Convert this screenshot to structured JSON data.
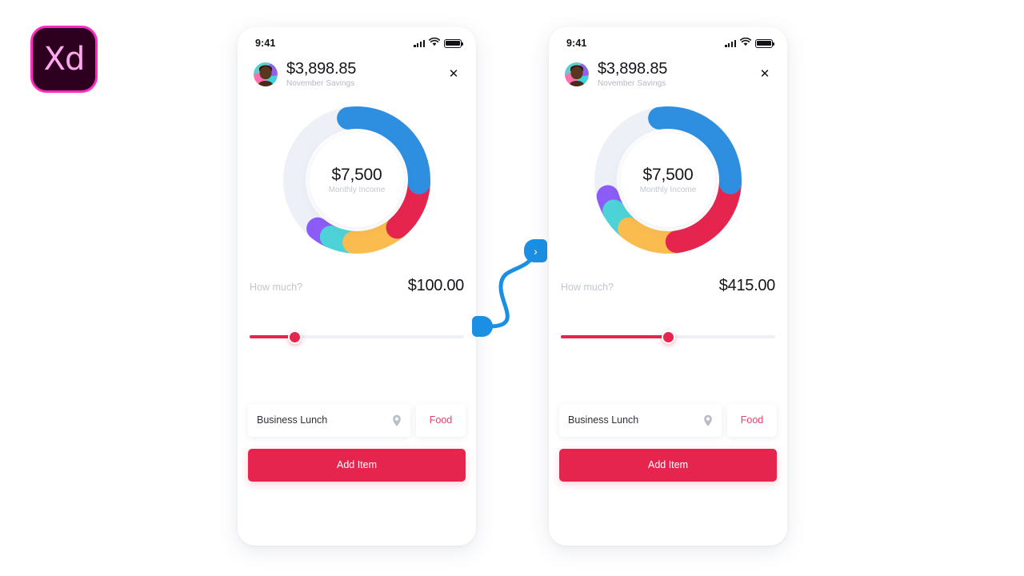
{
  "app": {
    "logo_text": "Xd",
    "logo_name": "adobe-xd-logo",
    "accent_pink": "#e6254f",
    "accent_blue": "#1a8fe3",
    "canvas_background": "#ffffff"
  },
  "connector": {
    "arrow_glyph": "›",
    "color": "#1a8fe3"
  },
  "screens": [
    {
      "id": "screen-1",
      "statusbar": {
        "time": "9:41",
        "signal_icon": "signal-bars-icon",
        "wifi_icon": "wifi-icon",
        "battery_icon": "battery-icon"
      },
      "header": {
        "avatar_name": "user-avatar",
        "amount": "$3,898.85",
        "subtitle": "November Savings",
        "close_glyph": "✕"
      },
      "donut": {
        "center_value": "$7,500",
        "center_label": "Monthly Income",
        "track_color": "#edf0f7"
      },
      "amount_row": {
        "label": "How much?",
        "value": "$100.00"
      },
      "slider": {
        "percent": 21,
        "fill_color": "#e6254f",
        "track_color": "#eef0f6"
      },
      "form": {
        "input_value": "Business Lunch",
        "input_placeholder": "Business Lunch",
        "pin_icon": "location-pin-icon",
        "tag_label": "Food",
        "button_label": "Add Item"
      },
      "chart_data": {
        "type": "pie",
        "title": "Monthly Income",
        "center_value": "$7,500",
        "center_label": "Monthly Income",
        "legend_position": "none",
        "categories": [
          "Blue",
          "Crimson",
          "Yellow",
          "Teal",
          "Purple"
        ],
        "values": [
          28,
          13,
          12,
          6,
          4
        ],
        "colors": [
          "#2e8fe0",
          "#e6254f",
          "#fbbc4f",
          "#4dd2d8",
          "#8b5cf6"
        ],
        "track_color": "#edf0f7",
        "start_angle_deg": -8,
        "total_ring_deg": 360
      }
    },
    {
      "id": "screen-2",
      "statusbar": {
        "time": "9:41",
        "signal_icon": "signal-bars-icon",
        "wifi_icon": "wifi-icon",
        "battery_icon": "battery-icon"
      },
      "header": {
        "avatar_name": "user-avatar",
        "amount": "$3,898.85",
        "subtitle": "November Savings",
        "close_glyph": "✕"
      },
      "donut": {
        "center_value": "$7,500",
        "center_label": "Monthly Income",
        "track_color": "#edf0f7"
      },
      "amount_row": {
        "label": "How much?",
        "value": "$415.00"
      },
      "slider": {
        "percent": 50,
        "fill_color": "#e6254f",
        "track_color": "#eef0f6"
      },
      "form": {
        "input_value": "Business Lunch",
        "input_placeholder": "Business Lunch",
        "pin_icon": "location-pin-icon",
        "tag_label": "Food",
        "button_label": "Add Item"
      },
      "chart_data": {
        "type": "pie",
        "title": "Monthly Income",
        "center_value": "$7,500",
        "center_label": "Monthly Income",
        "legend_position": "none",
        "categories": [
          "Blue",
          "Crimson",
          "Yellow",
          "Teal",
          "Purple"
        ],
        "values": [
          28,
          22,
          13,
          6,
          4
        ],
        "colors": [
          "#2e8fe0",
          "#e6254f",
          "#fbbc4f",
          "#4dd2d8",
          "#8b5cf6"
        ],
        "track_color": "#edf0f7",
        "start_angle_deg": -8,
        "total_ring_deg": 360
      }
    }
  ]
}
